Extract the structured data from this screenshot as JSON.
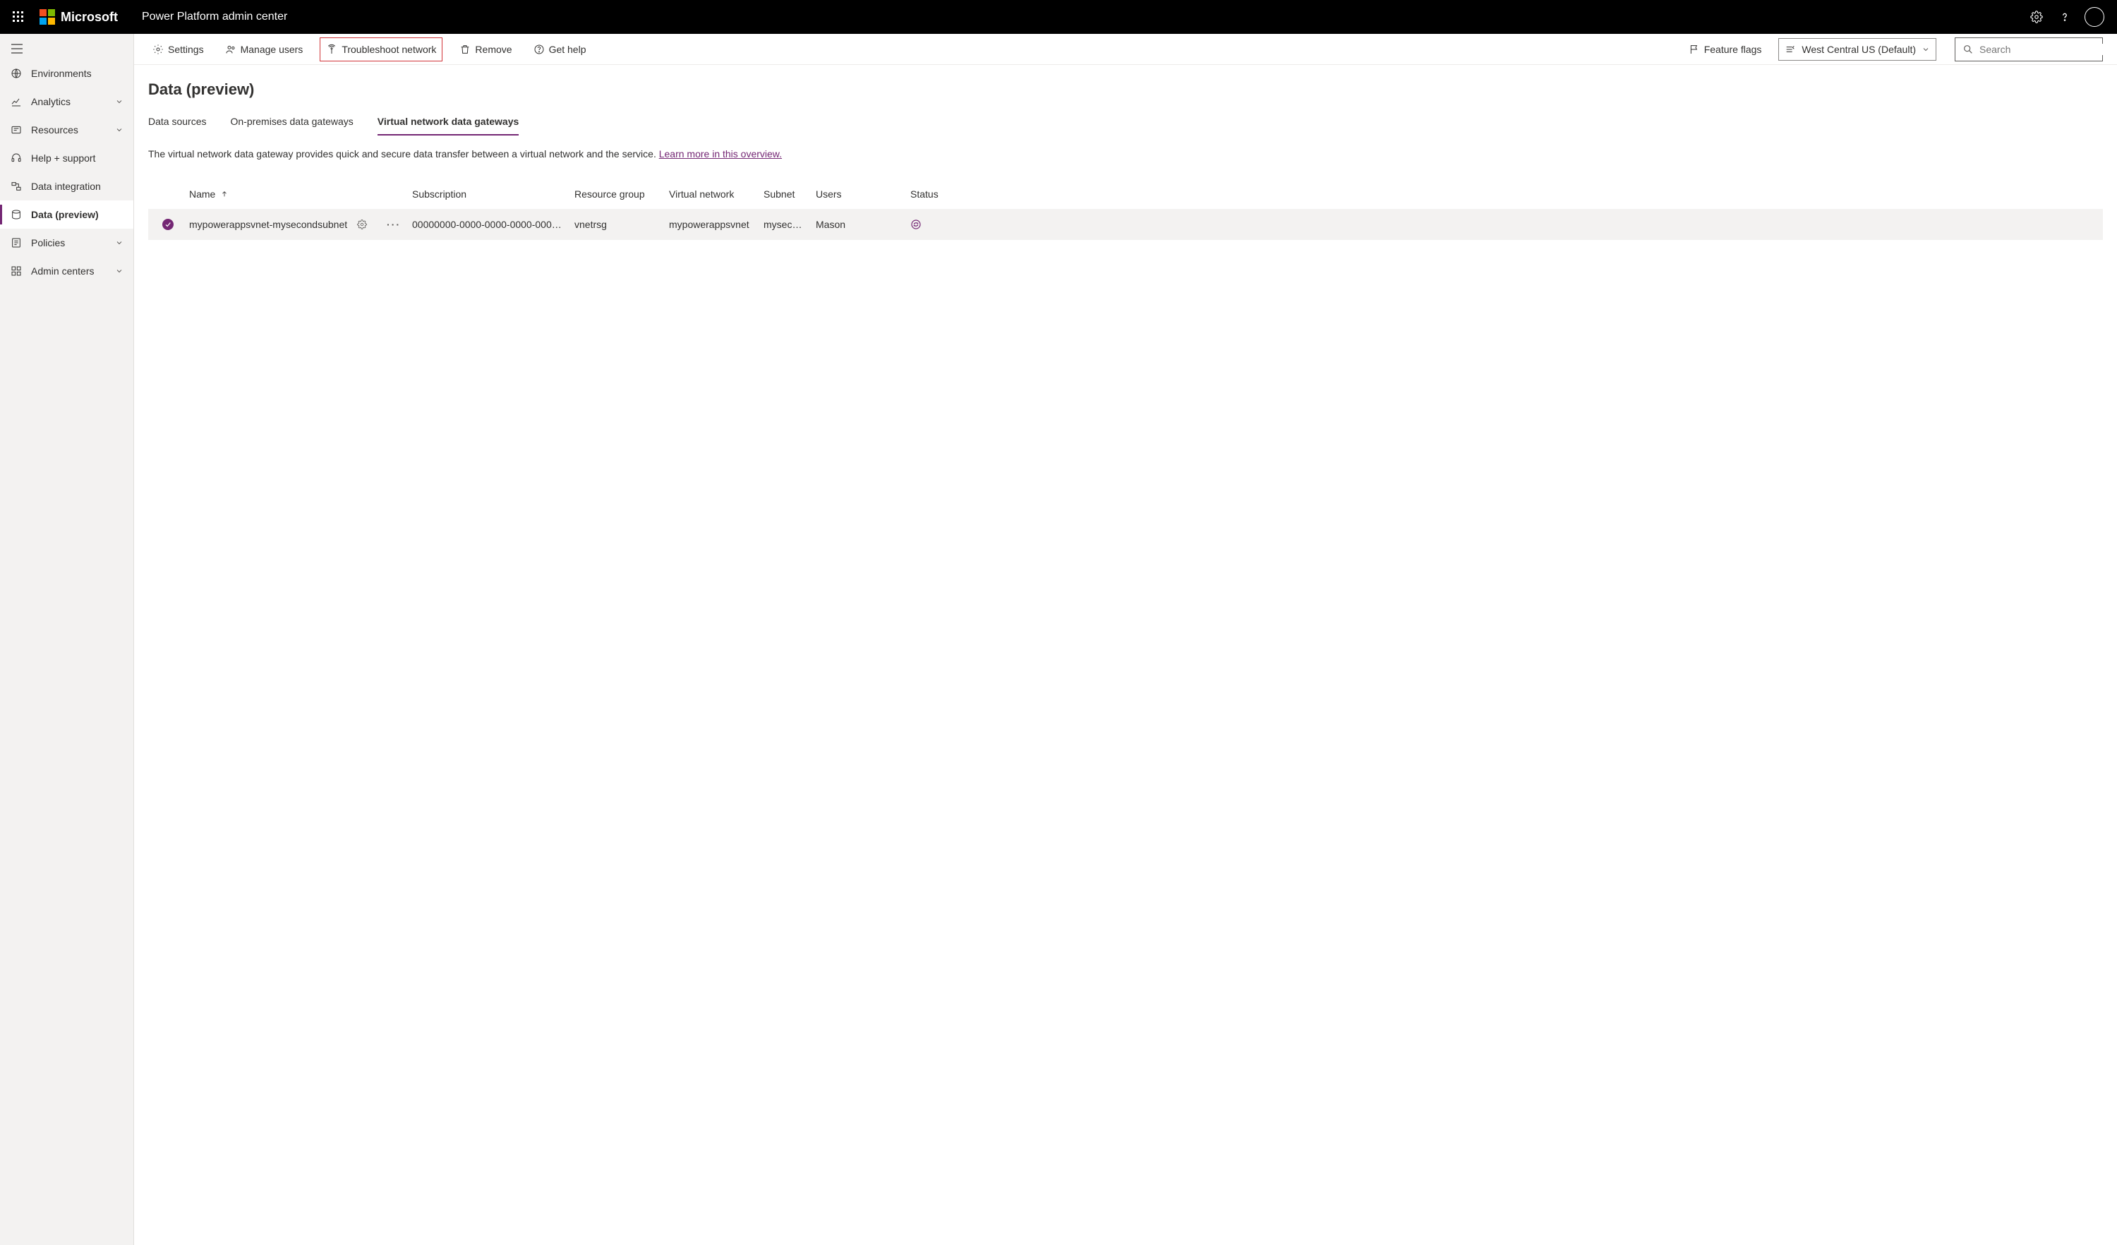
{
  "topbar": {
    "brand": "Microsoft",
    "app_title": "Power Platform admin center"
  },
  "sidebar": {
    "items": [
      {
        "id": "environments",
        "label": "Environments"
      },
      {
        "id": "analytics",
        "label": "Analytics",
        "expandable": true
      },
      {
        "id": "resources",
        "label": "Resources",
        "expandable": true
      },
      {
        "id": "help",
        "label": "Help + support"
      },
      {
        "id": "dataintegration",
        "label": "Data integration"
      },
      {
        "id": "datapreview",
        "label": "Data (preview)",
        "selected": true
      },
      {
        "id": "policies",
        "label": "Policies",
        "expandable": true
      },
      {
        "id": "admincenters",
        "label": "Admin centers",
        "expandable": true
      }
    ]
  },
  "cmdbar": {
    "settings": "Settings",
    "manage_users": "Manage users",
    "troubleshoot": "Troubleshoot network",
    "remove": "Remove",
    "get_help": "Get help",
    "feature_flags": "Feature flags",
    "environment": "West Central US (Default)",
    "search_placeholder": "Search"
  },
  "page": {
    "title": "Data (preview)",
    "tabs": [
      {
        "label": "Data sources"
      },
      {
        "label": "On-premises data gateways"
      },
      {
        "label": "Virtual network data gateways",
        "active": true
      }
    ],
    "desc_text": "The virtual network data gateway provides quick and secure data transfer between a virtual network and the service. ",
    "desc_link": "Learn more in this overview."
  },
  "table": {
    "headers": {
      "name": "Name",
      "subscription": "Subscription",
      "resource_group": "Resource group",
      "virtual_network": "Virtual network",
      "subnet": "Subnet",
      "users": "Users",
      "status": "Status"
    },
    "rows": [
      {
        "name": "mypowerappsvnet-mysecondsubnet",
        "subscription": "00000000-0000-0000-0000-0000…",
        "resource_group": "vnetrsg",
        "virtual_network": "mypowerappsvnet",
        "subnet": "myseco…",
        "users": "Mason"
      }
    ]
  }
}
